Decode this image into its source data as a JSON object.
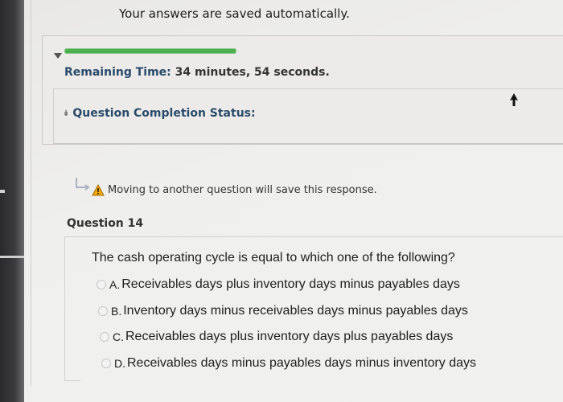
{
  "header": {
    "autosave_text": "Your answers are saved automatically."
  },
  "status": {
    "progress": 0.33,
    "remaining_label": "Remaining Time:",
    "remaining_value": "34 minutes, 54 seconds.",
    "completion_label": "Question Completion Status:"
  },
  "notice": {
    "text": "Moving to another question will save this response.",
    "icon": "warning-icon"
  },
  "question": {
    "title": "Question 14",
    "prompt": "The cash operating cycle is equal to which one of the following?",
    "options": [
      {
        "letter": "A.",
        "text": "Receivables days plus inventory days minus payables days"
      },
      {
        "letter": "B.",
        "text": "Inventory days minus receivables days minus payables days"
      },
      {
        "letter": "C.",
        "text": "Receivables days plus inventory days plus payables days"
      },
      {
        "letter": "D.",
        "text": "Receivables days minus payables days minus inventory days"
      }
    ]
  },
  "colors": {
    "progress": "#4caf50",
    "label_blue": "#2a4a6a",
    "warning": "#f2a900"
  }
}
